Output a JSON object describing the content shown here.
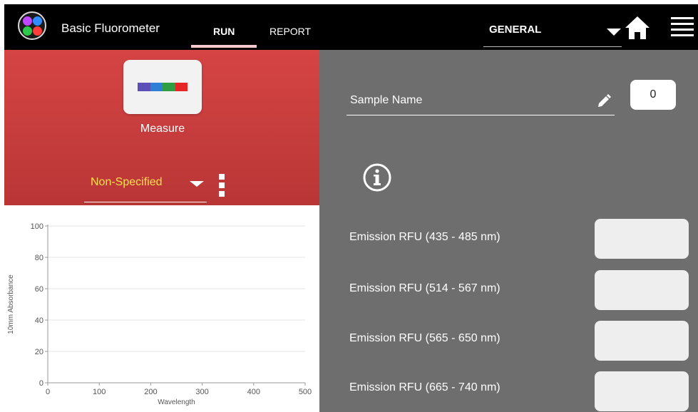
{
  "app": {
    "title": "Basic Fluorometer"
  },
  "tabs": [
    {
      "label": "RUN",
      "active": true
    },
    {
      "label": "REPORT",
      "active": false
    }
  ],
  "header": {
    "mode": "GENERAL",
    "home_icon": "home-icon",
    "menu_icon": "hamburger-menu-icon"
  },
  "left_panel": {
    "measure_label": "Measure",
    "spectrum_colors": [
      "#5b4fb8",
      "#2f7fd6",
      "#2f9e43",
      "#e62525"
    ],
    "sample_type": "Non-Specified"
  },
  "right_panel": {
    "sample_name_label": "Sample Name",
    "counter_value": "0",
    "emissions": [
      {
        "label": "Emission RFU (435 - 485 nm)",
        "value": ""
      },
      {
        "label": "Emission RFU (514 - 567 nm)",
        "value": ""
      },
      {
        "label": "Emission RFU (565 - 650 nm)",
        "value": ""
      },
      {
        "label": "Emission RFU (665 - 740 nm)",
        "value": ""
      }
    ]
  },
  "colors": {
    "topbar": "#000000",
    "accent_red": "#d64444",
    "panel_gray": "#6e6e6e",
    "highlight_yellow": "#ffe14d"
  },
  "chart_data": {
    "type": "line",
    "xlabel": "Wavelength",
    "ylabel": "10mm Absorbance",
    "xlim": [
      0,
      500
    ],
    "ylim": [
      0,
      100
    ],
    "x_ticks": [
      0,
      100,
      200,
      300,
      400,
      500
    ],
    "y_ticks": [
      0,
      20,
      40,
      60,
      80,
      100
    ],
    "grid": true,
    "series": []
  }
}
